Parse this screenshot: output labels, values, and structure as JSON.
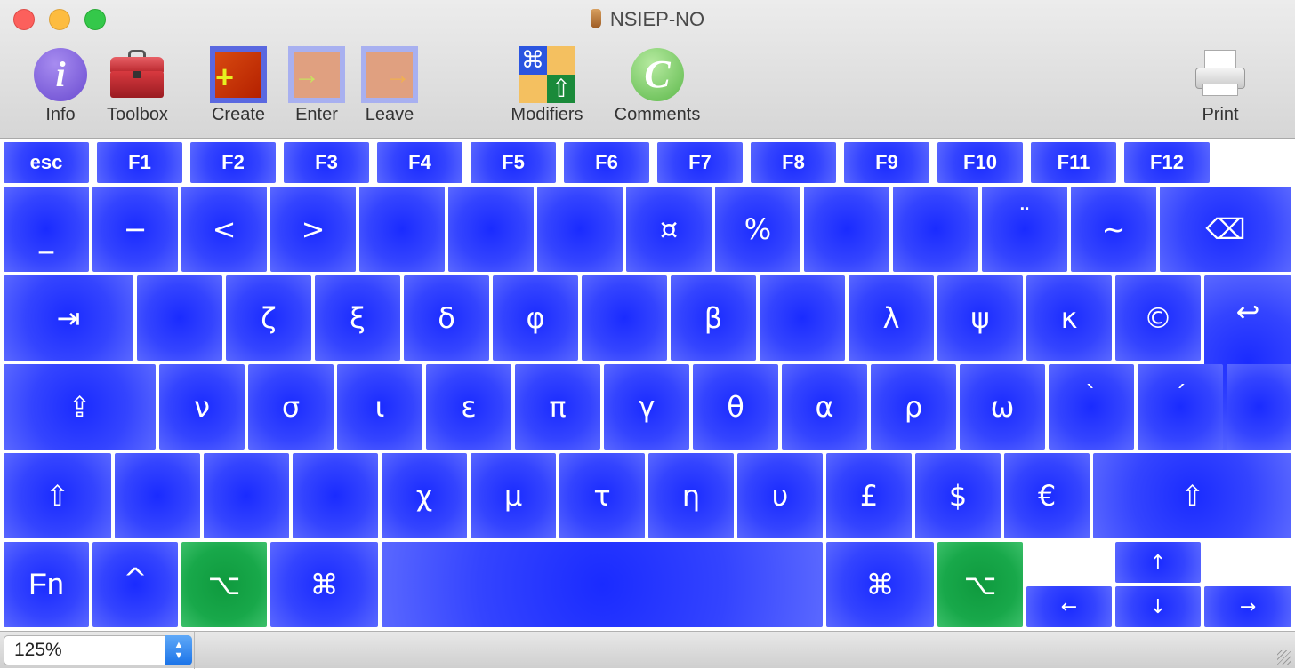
{
  "window": {
    "title": "NSIEP-NO"
  },
  "toolbar": {
    "info": "Info",
    "toolbox": "Toolbox",
    "create": "Create",
    "enter": "Enter",
    "leave": "Leave",
    "modifiers": "Modifiers",
    "comments": "Comments",
    "print": "Print"
  },
  "keyboard": {
    "function_row": [
      "esc",
      "F1",
      "F2",
      "F3",
      "F4",
      "F5",
      "F6",
      "F7",
      "F8",
      "F9",
      "F10",
      "F11",
      "F12"
    ],
    "number_row": [
      "_",
      "−",
      "<",
      ">",
      "",
      "",
      "",
      "¤",
      "%",
      "",
      "",
      "¨",
      "~",
      "⌫"
    ],
    "top_row": [
      "⇥",
      "",
      "ζ",
      "ξ",
      "δ",
      "φ",
      "",
      "β",
      "",
      "λ",
      "ψ",
      "κ",
      "©",
      "↩"
    ],
    "home_row": [
      "⇪",
      "ν",
      "σ",
      "ι",
      "ε",
      "π",
      "γ",
      "θ",
      "α",
      "ρ",
      "ω",
      "`",
      "´"
    ],
    "bottom_row": [
      "⇧",
      "",
      "",
      "",
      "χ",
      "μ",
      "τ",
      "η",
      "υ",
      "£",
      "$",
      "€",
      "⇧"
    ],
    "space_row": [
      "Fn",
      "^",
      "⌥",
      "⌘",
      "",
      "⌘",
      "⌥"
    ],
    "arrows": {
      "up": "↑",
      "left": "←",
      "down": "↓",
      "right": "→"
    },
    "colors": {
      "key": "#2233ff",
      "modifier_active": "#18a84a"
    }
  },
  "statusbar": {
    "zoom": "125%"
  }
}
